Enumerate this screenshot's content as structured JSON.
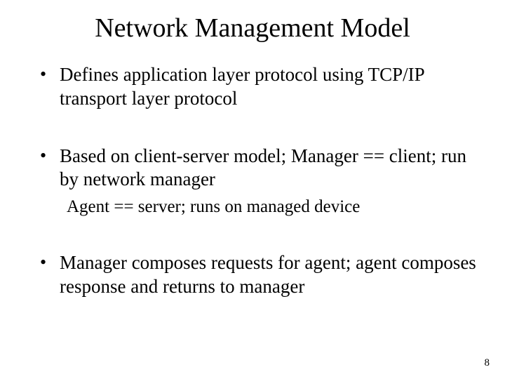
{
  "title": "Network Management Model",
  "bullets": [
    {
      "text": "Defines application layer protocol using TCP/IP transport layer protocol",
      "sub": null
    },
    {
      "text": "Based on client-server model; Manager == client; run by network manager",
      "sub": "Agent == server; runs on managed device"
    },
    {
      "text": "Manager composes requests for agent; agent composes response and returns to manager",
      "sub": null
    }
  ],
  "page_number": "8"
}
